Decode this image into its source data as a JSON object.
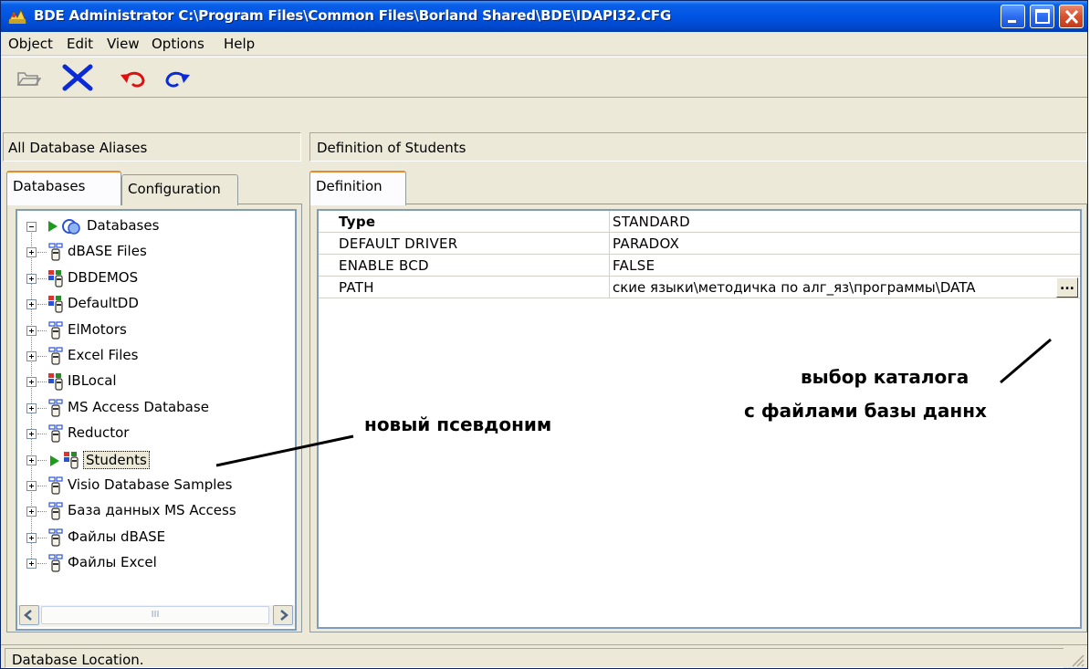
{
  "window": {
    "title": "BDE Administrator  C:\\Program Files\\Common Files\\Borland Shared\\BDE\\IDAPI32.CFG"
  },
  "menu": {
    "items": [
      "Object",
      "Edit",
      "View",
      "Options",
      "Help"
    ]
  },
  "toolbar": {
    "icons": [
      "open-folder-icon",
      "delete-icon",
      "undo-icon",
      "redo-icon"
    ]
  },
  "left_header": "All Database Aliases",
  "right_header": "Definition of Students",
  "left_tabs": [
    "Databases",
    "Configuration"
  ],
  "right_tabs": [
    "Definition"
  ],
  "tree": {
    "root": "Databases",
    "items": [
      {
        "label": "dBASE Files",
        "icon": "standard-db-icon"
      },
      {
        "label": "DBDEMOS",
        "icon": "paradox-db-icon"
      },
      {
        "label": "DefaultDD",
        "icon": "paradox-db-icon"
      },
      {
        "label": "ElMotors",
        "icon": "standard-db-icon"
      },
      {
        "label": "Excel Files",
        "icon": "standard-db-icon"
      },
      {
        "label": "IBLocal",
        "icon": "paradox-db-icon"
      },
      {
        "label": "MS Access Database",
        "icon": "standard-db-icon"
      },
      {
        "label": "Reductor",
        "icon": "standard-db-icon"
      },
      {
        "label": "Students",
        "icon": "paradox-db-icon",
        "selected": true
      },
      {
        "label": "Visio Database Samples",
        "icon": "standard-db-icon"
      },
      {
        "label": "База данных MS Access",
        "icon": "standard-db-icon"
      },
      {
        "label": "Файлы dBASE",
        "icon": "standard-db-icon"
      },
      {
        "label": "Файлы Excel",
        "icon": "standard-db-icon"
      }
    ]
  },
  "definition": {
    "rows": [
      {
        "key": "Type",
        "value": "STANDARD",
        "bold": true
      },
      {
        "key": "DEFAULT DRIVER",
        "value": "PARADOX"
      },
      {
        "key": "ENABLE BCD",
        "value": "FALSE"
      },
      {
        "key": "PATH",
        "value": "ские языки\\методичка по алг_яз\\программы\\DATA"
      }
    ],
    "browse_button": "..."
  },
  "annotations": {
    "new_alias": "новый псевдоним",
    "choose_dir_line1": "выбор каталога",
    "choose_dir_line2": "с файлами базы даннх"
  },
  "scrollbar": {
    "thumb_glyph": "III"
  },
  "status": "Database Location."
}
